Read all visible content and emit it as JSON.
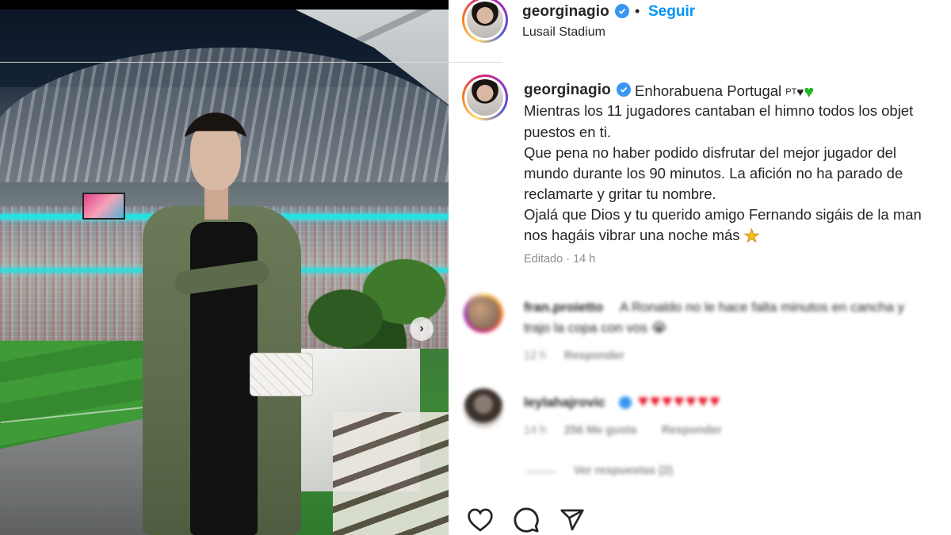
{
  "post": {
    "author": "georginagio",
    "dot": "•",
    "follow_label": "Seguir",
    "location": "Lusail Stadium",
    "carousel_next": "›"
  },
  "caption": {
    "author": "georginagio",
    "first_line": "Enhorabuena Portugal",
    "flag_text": "PT",
    "lines": [
      "Mientras los 11 jugadores cantaban el himno todos los objet",
      "puestos en ti.",
      "Que pena no haber podido disfrutar del mejor jugador del",
      "mundo durante los 90 minutos. La afición no ha parado de",
      "reclamarte y gritar tu nombre.",
      "Ojalá que Dios y tu querido amigo Fernando sigáis de la man",
      "nos hagáis vibrar una noche más"
    ],
    "edited": "Editado · 14 h"
  },
  "comments": [
    {
      "user": "fran.proietto",
      "text_line1": "A Ronaldo no le hace falta minutos en cancha y",
      "text_line2": "trajo la copa con vos 😭",
      "time": "12 h",
      "reply": "Responder"
    },
    {
      "user": "leylahajrovic",
      "hearts": "♥♥♥♥♥♥♥",
      "time": "14 h",
      "likes": "256 Me gusta",
      "reply": "Responder",
      "view_replies": "Ver respuestas (2)"
    }
  ],
  "colors": {
    "link_blue": "#0095f6",
    "verified_blue": "#3897f0",
    "muted": "#8e8e8e",
    "heart_red": "#e8172a",
    "heart_green": "#1fb81f"
  },
  "icons": [
    "like-icon",
    "comment-icon",
    "share-icon",
    "verified-icon",
    "chevron-right-icon"
  ]
}
